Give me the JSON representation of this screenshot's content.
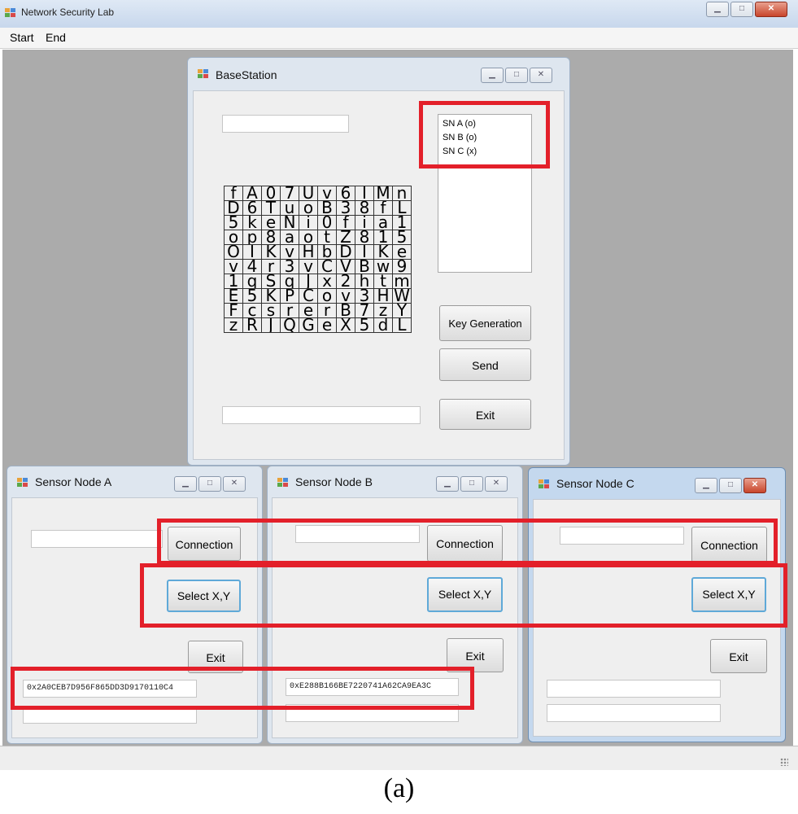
{
  "main_window": {
    "title": "Network Security Lab",
    "menu": [
      "Start",
      "End"
    ]
  },
  "base_station": {
    "title": "BaseStation",
    "top_textbox": "",
    "bottom_textbox": "",
    "sensor_list": [
      "SN  A (o)",
      "SN  B (o)",
      "SN  C (x)"
    ],
    "key_matrix": [
      "fA07Uv6IMn",
      "D6TuoB38fL",
      "5keNi0fia1",
      "op8aotZ815",
      "OIKvHbDIKe",
      "v4r3vCVBw9",
      "1qSqJx2htm",
      "E5KPCov3HW",
      "FcsrerB7zY",
      "zRJQGeX5dL"
    ],
    "key_generation_label": "Key Generation",
    "send_label": "Send",
    "exit_label": "Exit"
  },
  "sensor_nodes": [
    {
      "title": "Sensor Node A",
      "id_textbox": "",
      "connection_label": "Connection",
      "select_label": "Select X,Y",
      "exit_label": "Exit",
      "key_text": "0x2A0CEB7D956F865DD3D9170110C4",
      "second_textbox": ""
    },
    {
      "title": "Sensor Node B",
      "id_textbox": "",
      "connection_label": "Connection",
      "select_label": "Select X,Y",
      "exit_label": "Exit",
      "key_text": "0xE288B166BE7220741A62CA9EA3C",
      "second_textbox": ""
    },
    {
      "title": "Sensor Node C",
      "id_textbox": "",
      "connection_label": "Connection",
      "select_label": "Select X,Y",
      "exit_label": "Exit",
      "key_text": "",
      "second_textbox": ""
    }
  ],
  "caption": "(a)",
  "colors": {
    "highlight": "#e3202a",
    "client_bg": "#ababab",
    "focus_border": "#5fa9d8"
  }
}
